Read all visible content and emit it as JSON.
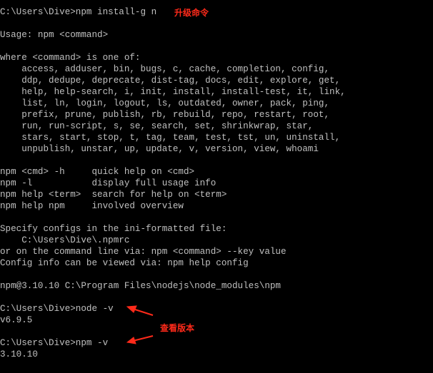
{
  "console": {
    "accent_red": "#ff2a1a",
    "text_color": "#c0c0c0",
    "lines": [
      "C:\\Users\\Dive>npm install-g n",
      "",
      "Usage: npm <command>",
      "",
      "where <command> is one of:",
      "    access, adduser, bin, bugs, c, cache, completion, config,",
      "    ddp, dedupe, deprecate, dist-tag, docs, edit, explore, get,",
      "    help, help-search, i, init, install, install-test, it, link,",
      "    list, ln, login, logout, ls, outdated, owner, pack, ping,",
      "    prefix, prune, publish, rb, rebuild, repo, restart, root,",
      "    run, run-script, s, se, search, set, shrinkwrap, star,",
      "    stars, start, stop, t, tag, team, test, tst, un, uninstall,",
      "    unpublish, unstar, up, update, v, version, view, whoami",
      "",
      "npm <cmd> -h     quick help on <cmd>",
      "npm -l           display full usage info",
      "npm help <term>  search for help on <term>",
      "npm help npm     involved overview",
      "",
      "Specify configs in the ini-formatted file:",
      "    C:\\Users\\Dive\\.npmrc",
      "or on the command line via: npm <command> --key value",
      "Config info can be viewed via: npm help config",
      "",
      "npm@3.10.10 C:\\Program Files\\nodejs\\node_modules\\npm",
      "",
      "C:\\Users\\Dive>node -v",
      "v6.9.5",
      "",
      "C:\\Users\\Dive>npm -v",
      "3.10.10"
    ]
  },
  "annotations": {
    "upgrade_label": "升级命令",
    "check_version_label": "查看版本"
  }
}
